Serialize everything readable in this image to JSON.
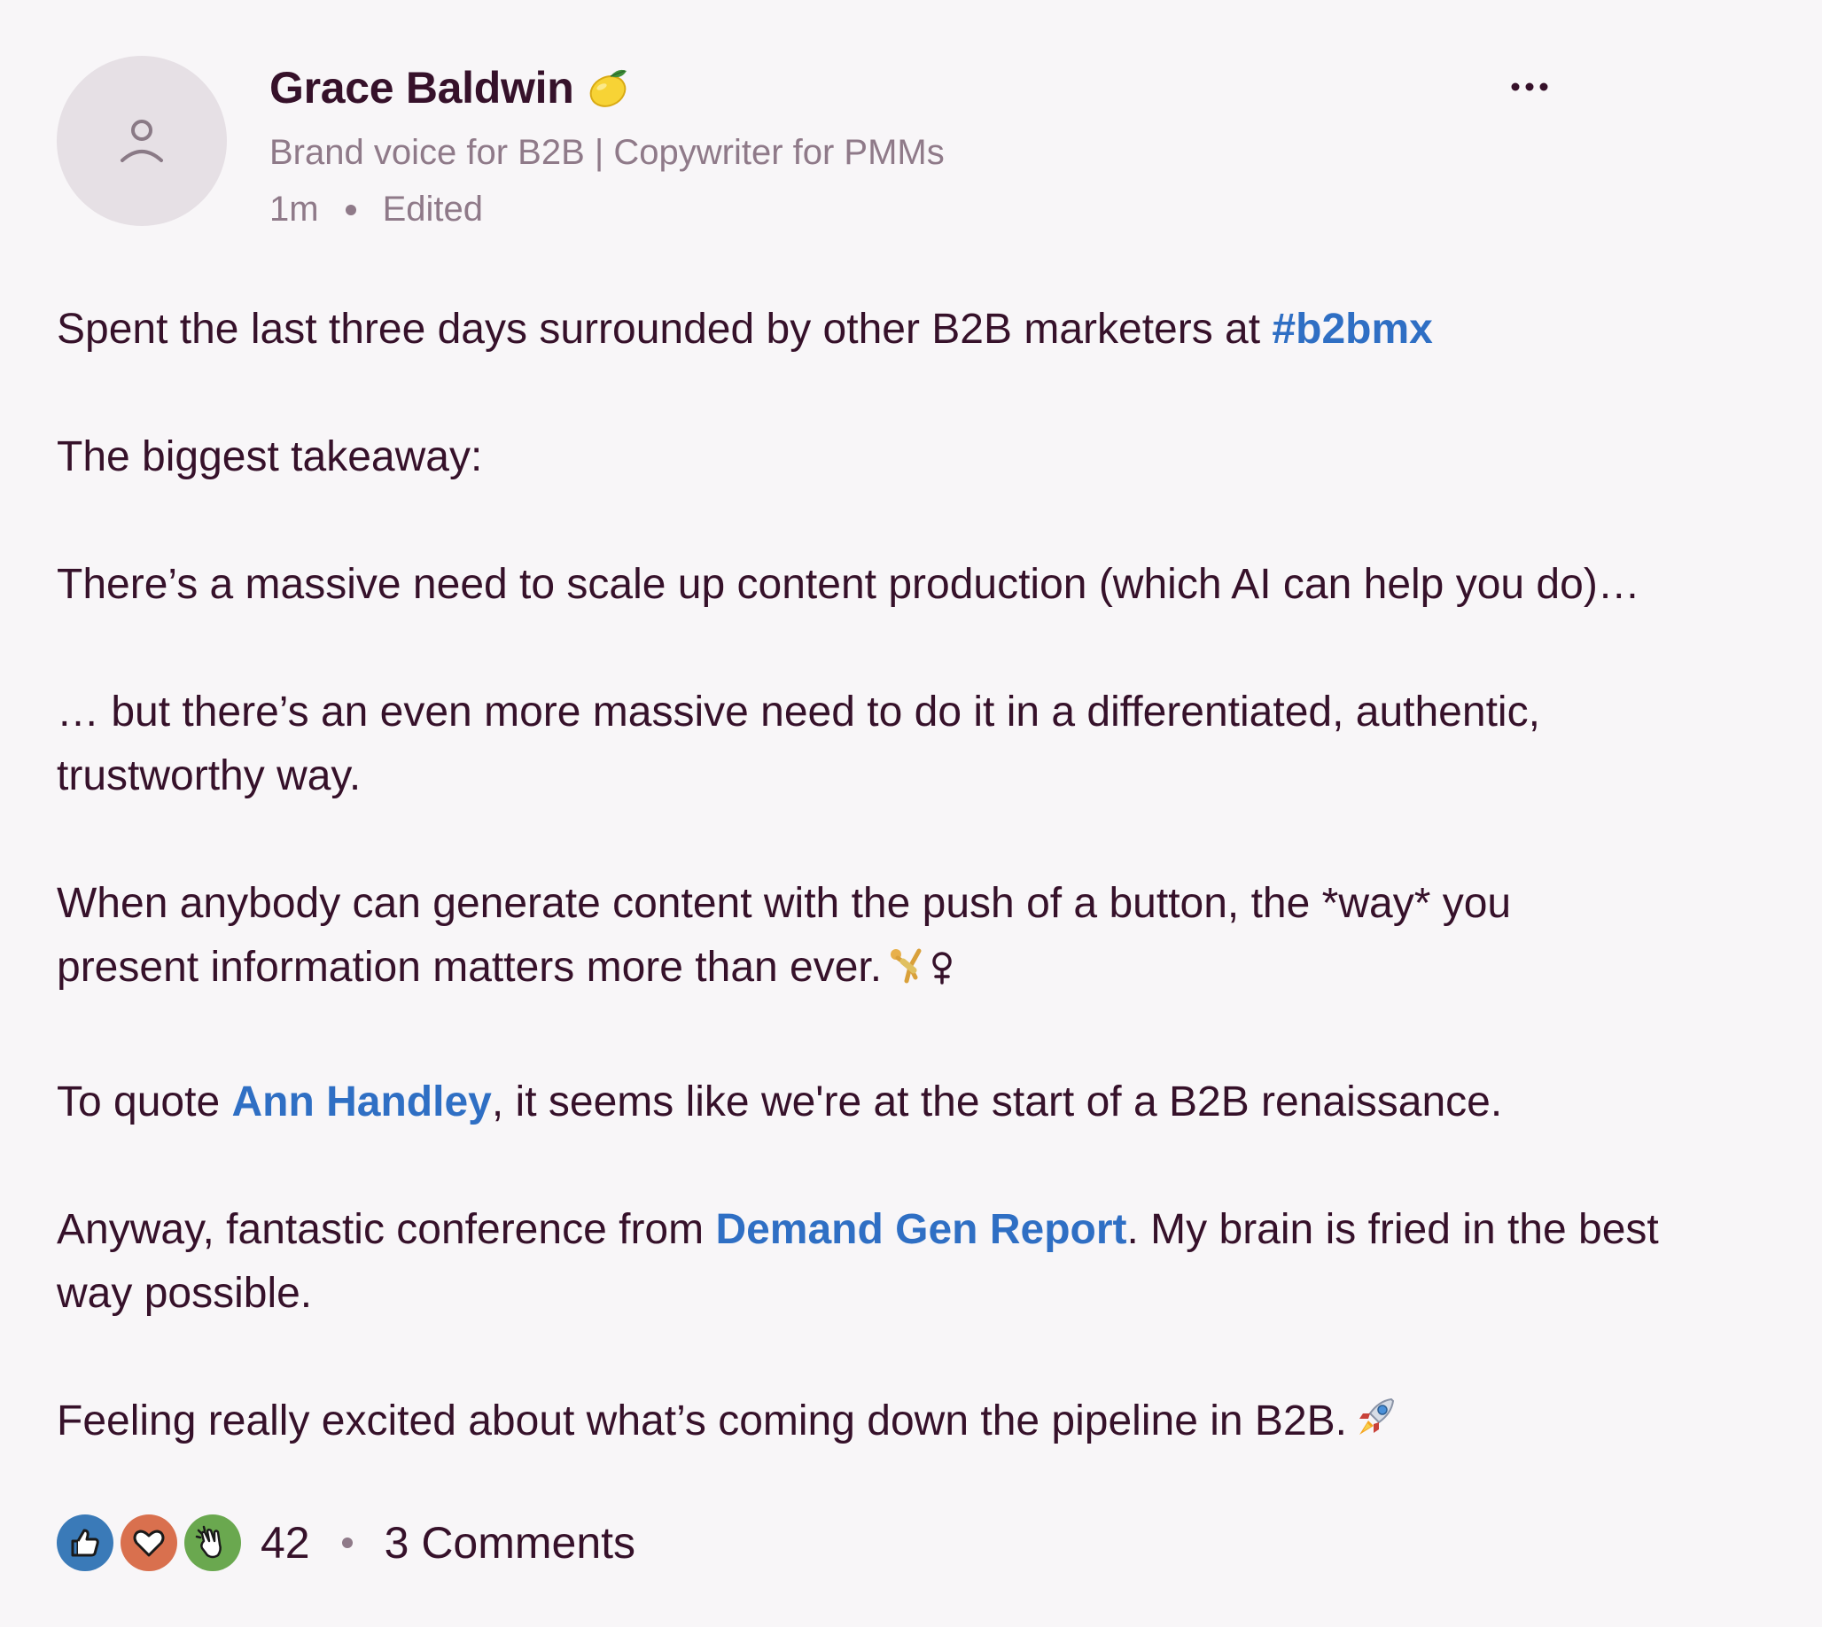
{
  "author": {
    "name": "Grace Baldwin",
    "name_emoji": "lemon-emoji",
    "headline": "Brand voice for B2B | Copywriter for PMMs",
    "time": "1m",
    "edited_label": "Edited"
  },
  "post": {
    "p1": {
      "text": "Spent the last three days surrounded by other B2B marketers at ",
      "hashtag": "#b2bmx"
    },
    "p2": "The biggest takeaway:",
    "p3": "There’s a massive need to scale up content production (which AI can help you do)…",
    "p4": {
      "line1": "… but there’s an even more massive need to do it in a differentiated, authentic,",
      "line2": "trustworthy way."
    },
    "p5": {
      "line1": "When anybody can generate content with the push of a button, the *way* you",
      "line2": "present information matters more than ever.",
      "emoji": "woman-cartwheeling-emoji"
    },
    "p6": {
      "before": "To quote ",
      "mention": "Ann Handley",
      "after": ", it seems like we're at the start of a B2B renaissance."
    },
    "p7": {
      "before": "Anyway, fantastic conference from ",
      "mention": "Demand Gen Report",
      "after": ". My brain is fried in the best",
      "line2": "way possible."
    },
    "p8": {
      "text": "Feeling really excited about what’s coming down the pipeline in B2B.",
      "emoji": "rocket-emoji"
    }
  },
  "footer": {
    "reactions": [
      {
        "name": "like",
        "icon": "thumbs-up-icon",
        "color": "#3a7ab8"
      },
      {
        "name": "love",
        "icon": "heart-icon",
        "color": "#d9704e"
      },
      {
        "name": "celebrate",
        "icon": "clapping-hands-icon",
        "color": "#6aa84f"
      }
    ],
    "reaction_count": "42",
    "comments_label": "3 Comments"
  },
  "colors": {
    "background": "#f8f6f8",
    "text": "#36112a",
    "muted": "#8f7a89",
    "link": "#2f6fc4",
    "avatar_bg": "#e6e0e5"
  }
}
